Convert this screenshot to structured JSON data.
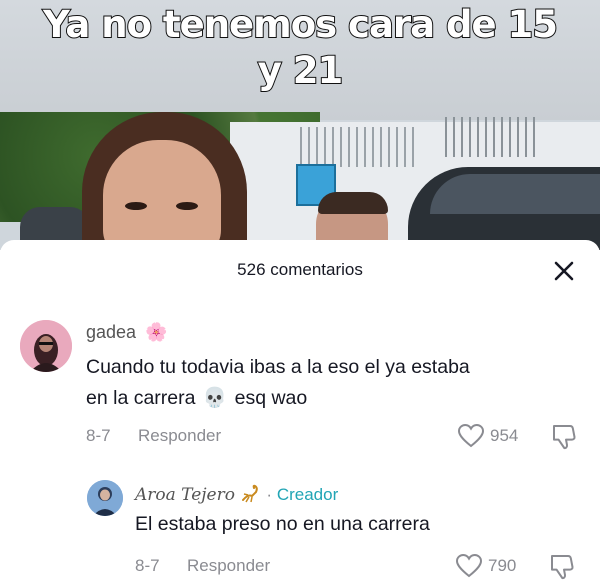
{
  "video": {
    "caption_line1": "Ya no tenemos cara de 15",
    "caption_line2": "y 21"
  },
  "comments_panel": {
    "title": "526 comentarios",
    "close_icon": "close-icon"
  },
  "comments": [
    {
      "username": "gadea",
      "username_emoji": "🌸",
      "text_line1": "Cuando tu todavia ibas a la eso el ya estaba",
      "text_line2_a": "en la carrera",
      "text_emoji": "💀",
      "text_line2_b": "esq wao",
      "date": "8-7",
      "reply_label": "Responder",
      "likes": "954"
    }
  ],
  "reply": {
    "username": "Aroa Tejero",
    "separator": "·",
    "badge": "Creador",
    "text": "El estaba preso no en una carrera",
    "date": "8-7",
    "reply_label": "Responder",
    "likes": "790"
  },
  "colors": {
    "creator_badge": "#22a5b5",
    "muted_text": "#8a8b91",
    "primary_text": "#161823"
  }
}
